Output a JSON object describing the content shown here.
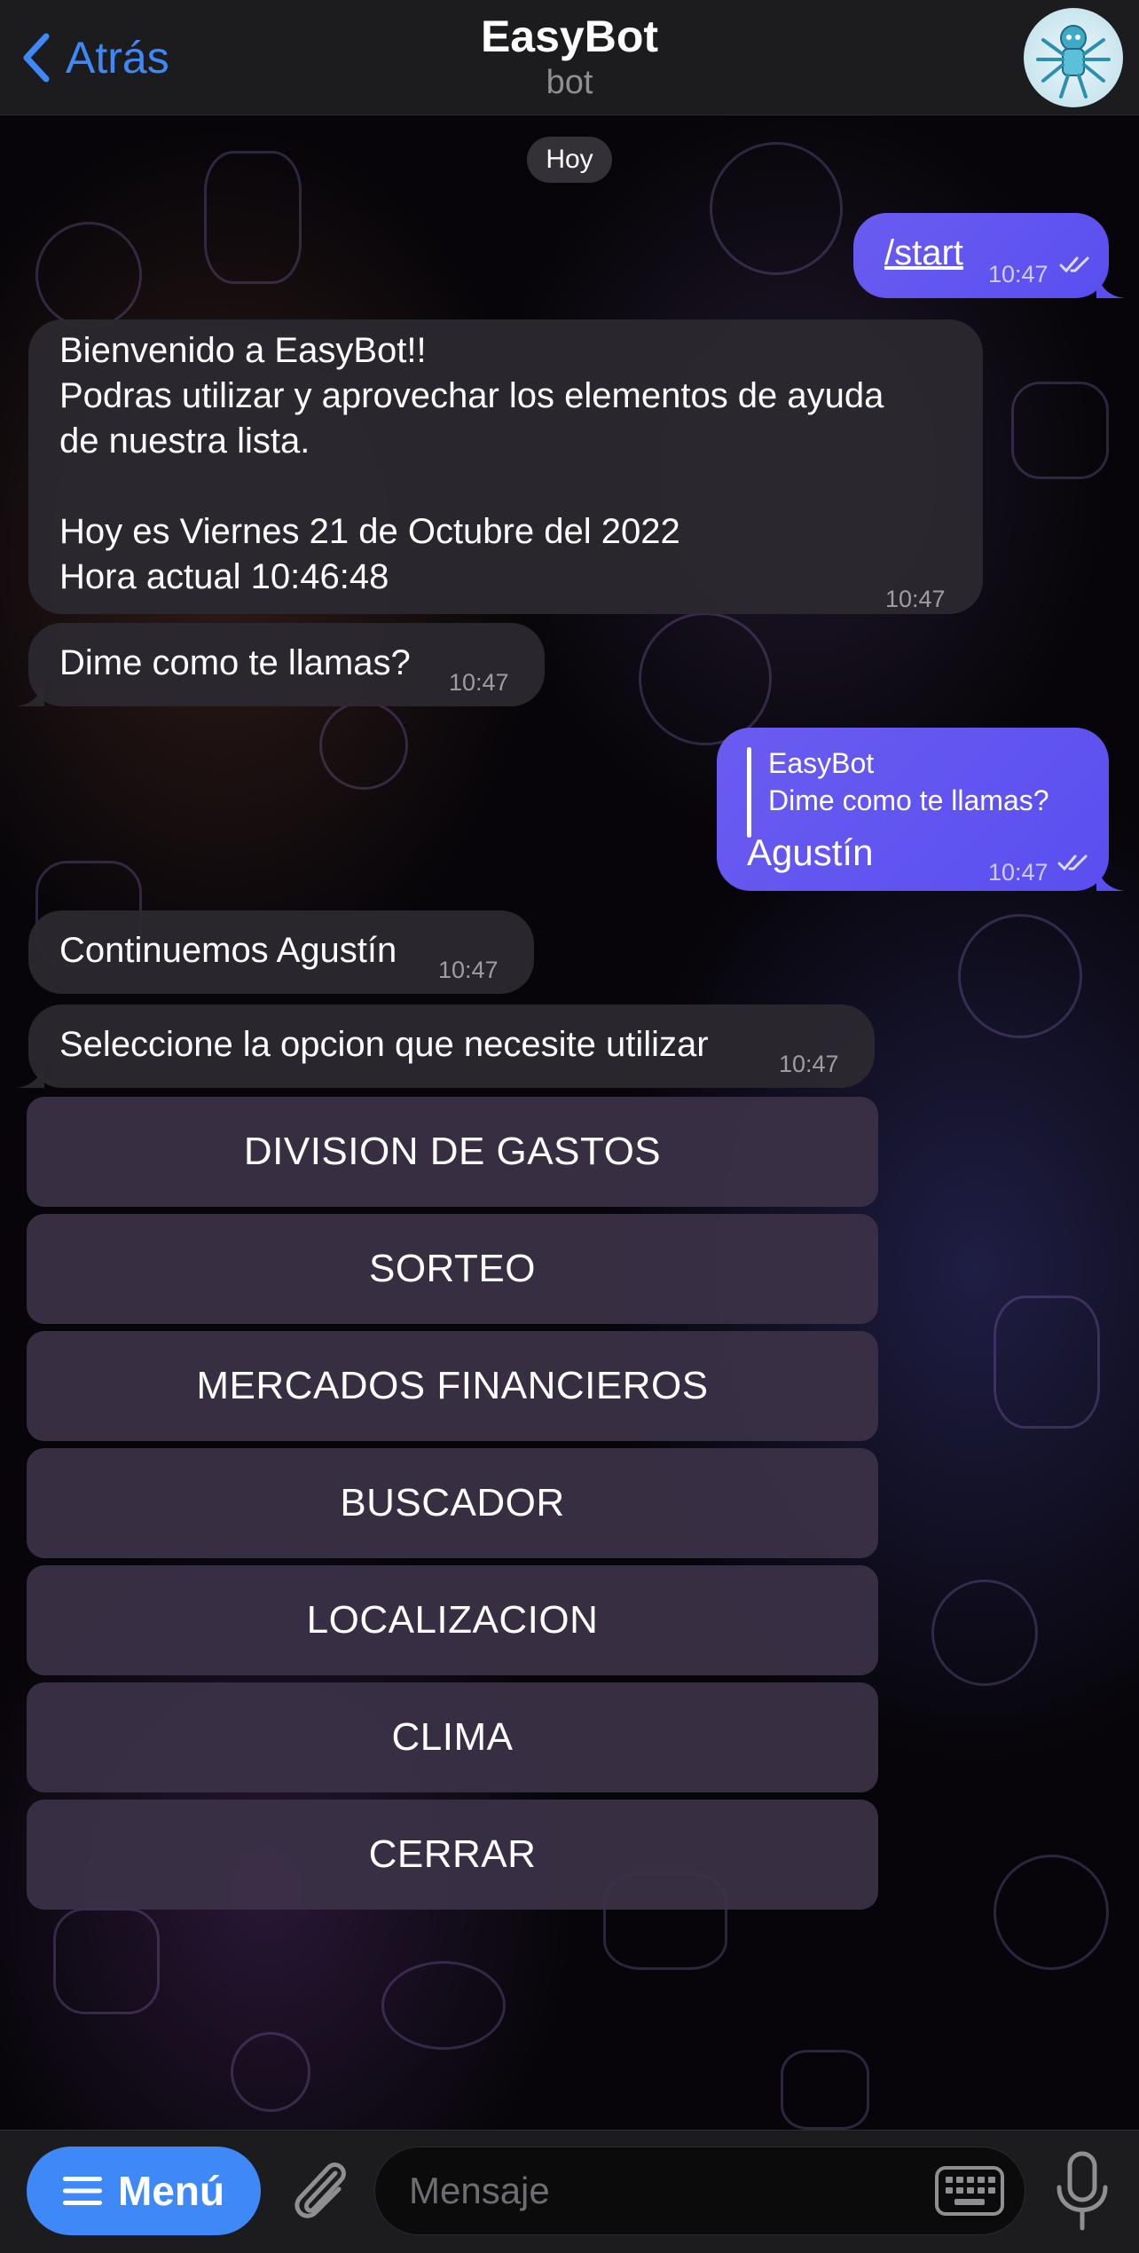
{
  "header": {
    "back_label": "Atrás",
    "title": "EasyBot",
    "subtitle": "bot"
  },
  "date_chip": "Hoy",
  "messages": [
    {
      "direction": "out",
      "command": "/start",
      "time": "10:47",
      "status": "read"
    },
    {
      "direction": "in",
      "lines": [
        "Bienvenido a EasyBot!!",
        "Podras utilizar y aprovechar los elementos de ayuda",
        "de nuestra lista.",
        "",
        "Hoy es Viernes 21 de Octubre del 2022",
        "Hora actual 10:46:48"
      ],
      "time": "10:47"
    },
    {
      "direction": "in",
      "text": "Dime como te llamas?",
      "time": "10:47"
    },
    {
      "direction": "out",
      "reply_to": {
        "author": "EasyBot",
        "text": "Dime como te llamas?"
      },
      "text": "Agustín",
      "time": "10:47",
      "status": "read"
    },
    {
      "direction": "in",
      "text": "Continuemos Agustín",
      "time": "10:47"
    },
    {
      "direction": "in",
      "text": "Seleccione la opcion que necesite utilizar",
      "time": "10:47"
    }
  ],
  "keyboard_buttons": [
    "DIVISION DE GASTOS",
    "SORTEO",
    "MERCADOS FINANCIEROS",
    "BUSCADOR",
    "LOCALIZACION",
    "CLIMA",
    "CERRAR"
  ],
  "bottom_bar": {
    "menu_label": "Menú",
    "input_placeholder": "Mensaje",
    "input_value": ""
  },
  "colors": {
    "accent": "#3e88f7",
    "outgoing_bubble": "#5a4ef0",
    "incoming_bubble": "#2c2830",
    "keyboard_button": "#3c3248",
    "bar_background": "#1c1c1e"
  },
  "icons": [
    "chevron-left-icon",
    "bot-avatar",
    "double-check-icon",
    "hamburger-icon",
    "paperclip-icon",
    "keyboard-icon",
    "microphone-icon"
  ]
}
